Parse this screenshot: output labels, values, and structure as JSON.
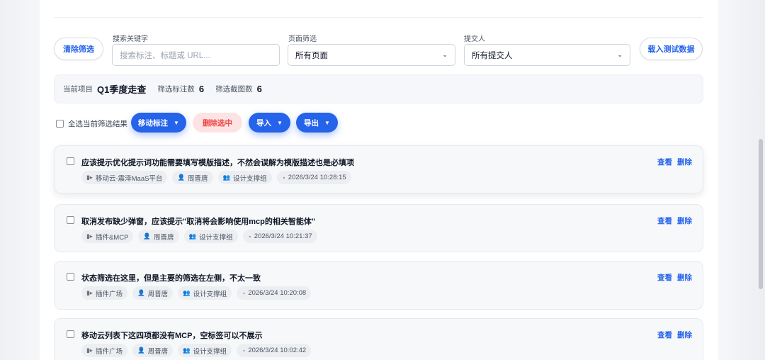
{
  "filters": {
    "clear_label": "清除筛选",
    "keyword_label": "搜索关键字",
    "keyword_placeholder": "搜索标注、标题或 URL...",
    "page_label": "页面筛选",
    "page_value": "所有页面",
    "submitter_label": "提交人",
    "submitter_value": "所有提交人",
    "load_test_label": "载入测试数据"
  },
  "project": {
    "current_label": "当前项目",
    "current_value": "Q1季度走查",
    "annotations_label": "筛选标注数",
    "annotations_count": "6",
    "screenshots_label": "筛选截图数",
    "screenshots_count": "6"
  },
  "bulk": {
    "select_all_label": "全选当前筛选结果",
    "move_label": "移动标注",
    "delete_selected_label": "删除选中",
    "import_label": "导入",
    "export_label": "导出",
    "caret": "▼"
  },
  "icons": {
    "page": "▮▸",
    "user": "👤",
    "group": "👥",
    "clock": "◔"
  },
  "items": [
    {
      "title": "应该提示优化提示词功能需要填写模版描述，不然会误解为模版描述也是必填项",
      "page": "移动云-震泽MaaS平台",
      "user": "周晋唐",
      "group": "设计支撑组",
      "time": "2026/3/24 10:28:15",
      "view": "查看",
      "delete": "删除"
    },
    {
      "title": "取消发布缺少弹窗，应该提示\"取消将会影响使用mcp的相关智能体\"",
      "page": "插件&MCP",
      "user": "周晋唐",
      "group": "设计支撑组",
      "time": "2026/3/24 10:21:37",
      "view": "查看",
      "delete": "删除"
    },
    {
      "title": "状态筛选在这里，但是主要的筛选在左侧，不太一致",
      "page": "插件广场",
      "user": "周晋唐",
      "group": "设计支撑组",
      "time": "2026/3/24 10:20:08",
      "view": "查看",
      "delete": "删除"
    },
    {
      "title": "移动云列表下这四项都没有MCP，空标签可以不展示",
      "page": "插件广场",
      "user": "周晋唐",
      "group": "设计支撑组",
      "time": "2026/3/24 10:02:42",
      "view": "查看",
      "delete": "删除"
    }
  ],
  "colors": {
    "accent": "#2563eb",
    "danger": "#ef4444",
    "danger_bg": "#fde3e3"
  }
}
